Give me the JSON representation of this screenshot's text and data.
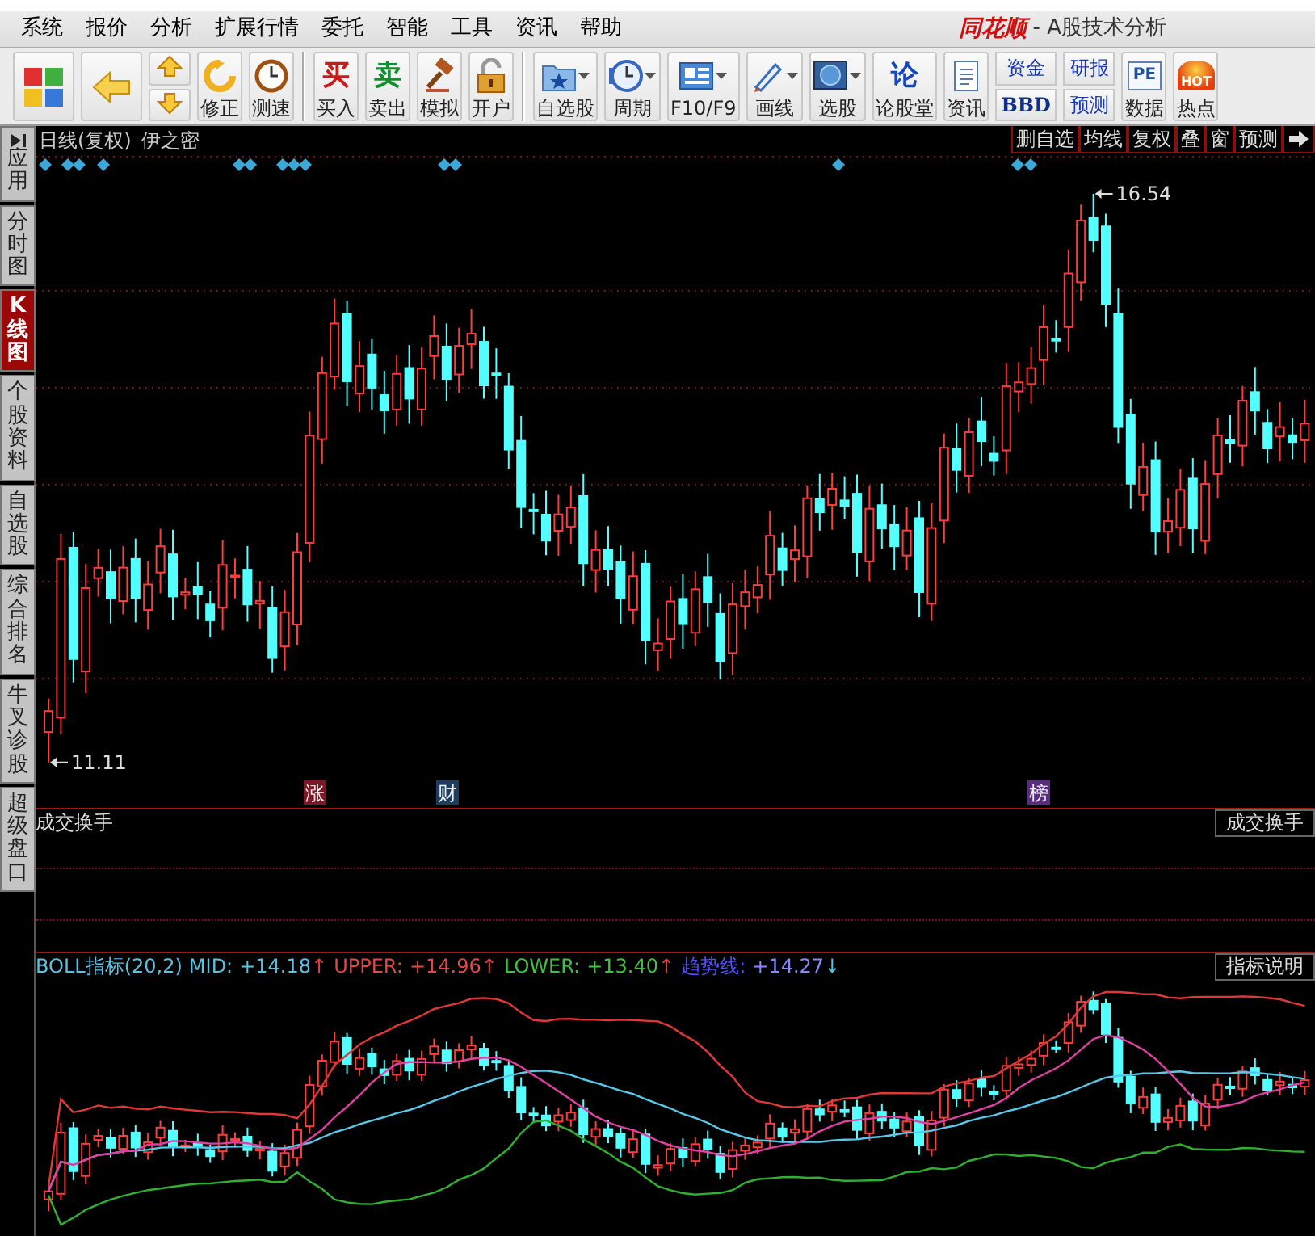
{
  "menu": [
    "系统",
    "报价",
    "分析",
    "扩展行情",
    "委托",
    "智能",
    "工具",
    "资讯",
    "帮助"
  ],
  "app_title": {
    "logo": "同花顺",
    "subtitle": "- A股技术分析"
  },
  "toolbar": [
    {
      "kind": "big"
    },
    {
      "kind": "big"
    },
    {
      "kind": "updown"
    },
    {
      "kind": "tool",
      "label": "修正"
    },
    {
      "kind": "tool",
      "label": "测速"
    },
    {
      "kind": "separator"
    },
    {
      "kind": "tool",
      "label": "买入",
      "glyph": "买"
    },
    {
      "kind": "tool",
      "label": "卖出",
      "glyph": "卖"
    },
    {
      "kind": "tool",
      "label": "模拟"
    },
    {
      "kind": "tool",
      "label": "开户"
    },
    {
      "kind": "separator"
    },
    {
      "kind": "dropdown",
      "label": "自选股"
    },
    {
      "kind": "dropdown",
      "label": "周期"
    },
    {
      "kind": "dropdown",
      "label": "F10/F9"
    },
    {
      "kind": "dropdown",
      "label": "画线"
    },
    {
      "kind": "dropdown",
      "label": "选股"
    },
    {
      "kind": "tool",
      "label": "论股堂",
      "glyph": "论"
    },
    {
      "kind": "tool",
      "label": "资讯"
    },
    {
      "kind": "pair",
      "top": "资金",
      "bottom": "BBD"
    },
    {
      "kind": "pair",
      "top": "研报",
      "bottom": "预测"
    },
    {
      "kind": "tool",
      "label": "数据",
      "glyph": "PE"
    },
    {
      "kind": "tool",
      "label": "热点",
      "glyph": "HOT"
    }
  ],
  "side_tabs": [
    {
      "label": "应用",
      "selected": false
    },
    {
      "label": "分时图",
      "selected": false
    },
    {
      "label": "K线图",
      "selected": true
    },
    {
      "label": "个股资料",
      "selected": false
    },
    {
      "label": "自选股",
      "selected": false
    },
    {
      "label": "综合排名",
      "selected": false
    },
    {
      "label": "牛叉诊股",
      "selected": false
    },
    {
      "label": "超级盘口",
      "selected": false
    }
  ],
  "price_chart": {
    "title": "日线(复权)",
    "stock": "伊之密",
    "buttons": [
      "删自选",
      "均线",
      "复权",
      "叠",
      "窗",
      "预测"
    ],
    "high_label": "16.54",
    "low_label": "11.11",
    "tags": [
      {
        "label": "涨",
        "color": "#7a1828"
      },
      {
        "label": "财",
        "color": "#1c3c60"
      },
      {
        "label": "榜",
        "color": "#5a2c80"
      }
    ]
  },
  "volume_panel": {
    "title": "成交换手",
    "button": "成交换手"
  },
  "boll_panel": {
    "title": "BOLL指标(20,2)",
    "button": "指标说明",
    "items": [
      {
        "label": "MID:",
        "value": "+14.18",
        "arrow": "↑",
        "color": "#5cc0e0",
        "kind": "rising"
      },
      {
        "label": "UPPER:",
        "value": "+14.96",
        "arrow": "↑",
        "color": "#e04848",
        "kind": "rising"
      },
      {
        "label": "LOWER:",
        "value": "+13.40",
        "arrow": "↑",
        "color": "#40c040",
        "kind": "rising"
      },
      {
        "label": "趋势线:",
        "value": "+14.27",
        "arrow": "↓",
        "color": "#5050ff",
        "kind": "falling"
      }
    ]
  }
}
